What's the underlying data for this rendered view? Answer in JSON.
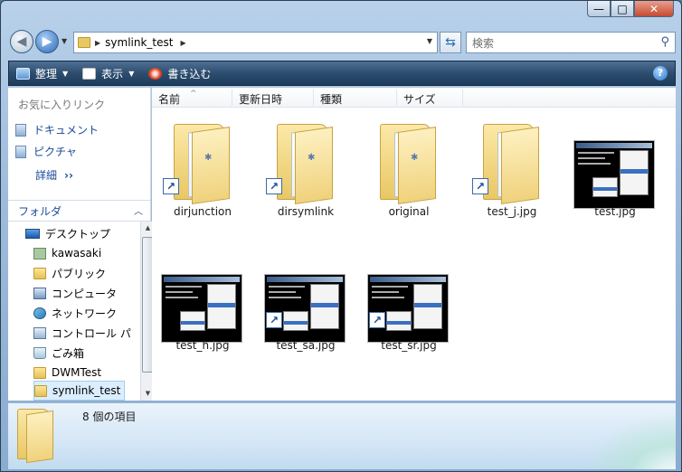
{
  "window": {
    "min_glyph": "—",
    "max_glyph": "□",
    "close_glyph": "✕"
  },
  "address": {
    "current_folder": "symlink_test",
    "search_placeholder": "検索"
  },
  "toolbar": {
    "organize_label": "整理",
    "view_label": "表示",
    "burn_label": "書き込む",
    "help_glyph": "?"
  },
  "navpane": {
    "favorites_title": "お気に入りリンク",
    "favorites": [
      {
        "label": "ドキュメント"
      },
      {
        "label": "ピクチャ"
      }
    ],
    "more_label": "詳細",
    "folders_title": "フォルダ",
    "tree": [
      {
        "label": "デスクトップ"
      },
      {
        "label": "kawasaki"
      },
      {
        "label": "パブリック"
      },
      {
        "label": "コンピュータ"
      },
      {
        "label": "ネットワーク"
      },
      {
        "label": "コントロール パ"
      },
      {
        "label": "ごみ箱"
      },
      {
        "label": "DWMTest"
      },
      {
        "label": "symlink_test"
      }
    ]
  },
  "columns": [
    "名前",
    "更新日時",
    "種類",
    "サイズ"
  ],
  "files": [
    {
      "name": "dirjunction",
      "kind": "folder",
      "shortcut": true,
      "badge": true
    },
    {
      "name": "dirsymlink",
      "kind": "folder",
      "shortcut": true,
      "badge": true
    },
    {
      "name": "original",
      "kind": "folder",
      "shortcut": false,
      "badge": true
    },
    {
      "name": "test_j.jpg",
      "kind": "folder",
      "shortcut": true,
      "badge": false
    },
    {
      "name": "test.jpg",
      "kind": "image",
      "shortcut": false
    },
    {
      "name": "test_h.jpg",
      "kind": "image",
      "shortcut": false
    },
    {
      "name": "test_sa.jpg",
      "kind": "image",
      "shortcut": true
    },
    {
      "name": "test_sr.jpg",
      "kind": "image",
      "shortcut": true
    }
  ],
  "details": {
    "count_text": "8 個の項目"
  }
}
